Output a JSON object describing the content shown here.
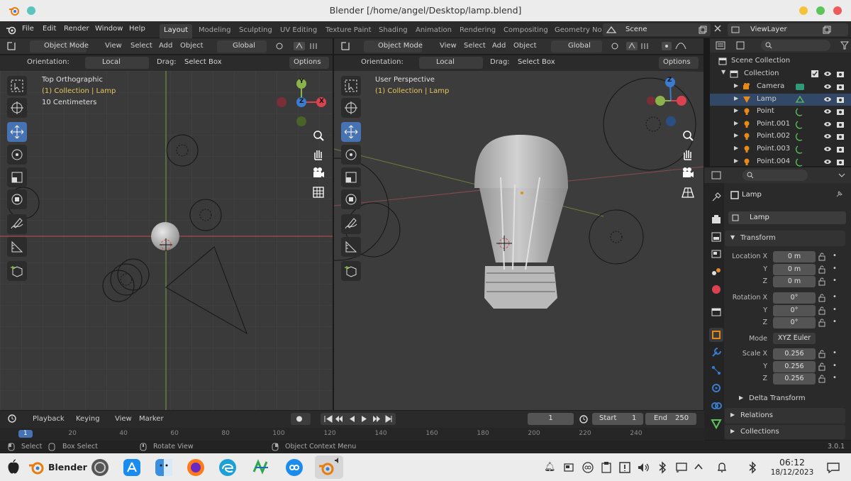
{
  "window": {
    "title": "Blender [/home/angel/Desktop/lamp.blend]"
  },
  "menu": [
    "File",
    "Edit",
    "Render",
    "Window",
    "Help"
  ],
  "workspaces": [
    "Layout",
    "Modeling",
    "Sculpting",
    "UV Editing",
    "Texture Paint",
    "Shading",
    "Animation",
    "Rendering",
    "Compositing",
    "Geometry No"
  ],
  "active_workspace": "Layout",
  "scene": "Scene",
  "view_layer": "ViewLayer",
  "viewport_header": {
    "mode": "Object Mode",
    "menus": [
      "View",
      "Select",
      "Add",
      "Object"
    ],
    "transform": "Global",
    "orientation_label": "Orientation:",
    "orientation_value": "Local",
    "drag_label": "Drag:",
    "drag_value": "Select Box",
    "options": "Options"
  },
  "viewport_left": {
    "title": "Top Orthographic",
    "collection": "(1) Collection | Lamp",
    "scale": "10 Centimeters"
  },
  "viewport_right": {
    "title": "User Perspective",
    "collection": "(1) Collection | Lamp"
  },
  "gizmo": {
    "x": "X",
    "y": "Y",
    "z": "Z"
  },
  "outliner": {
    "root": "Scene Collection",
    "collection": "Collection",
    "items": [
      "Camera",
      "Lamp",
      "Point",
      "Point.001",
      "Point.002",
      "Point.003",
      "Point.004"
    ]
  },
  "properties": {
    "object_name": "Lamp",
    "data_name": "Lamp",
    "transform_header": "Transform",
    "location_label": "Location X",
    "rotation_label": "Rotation X",
    "scale_label": "Scale X",
    "y_label": "Y",
    "z_label": "Z",
    "location": [
      "0 m",
      "0 m",
      "0 m"
    ],
    "rotation": [
      "0°",
      "0°",
      "0°"
    ],
    "mode_label": "Mode",
    "mode_value": "XYZ Euler",
    "scale": [
      "0.256",
      "0.256",
      "0.256"
    ],
    "delta_transform": "Delta Transform",
    "relations": "Relations",
    "collections": "Collections"
  },
  "timeline": {
    "menus": [
      "Playback",
      "Keying",
      "View",
      "Marker"
    ],
    "current_frame": "1",
    "start_label": "Start",
    "start": "1",
    "end_label": "End",
    "end": "250",
    "ruler": [
      "1",
      "20",
      "40",
      "60",
      "80",
      "100",
      "120",
      "140",
      "160",
      "180",
      "200",
      "220",
      "240"
    ]
  },
  "statusbar": {
    "select": "Select",
    "box_select": "Box Select",
    "rotate_view": "Rotate View",
    "context_menu": "Object Context Menu",
    "version": "3.0.1"
  },
  "dock": {
    "app_name": "Blender",
    "time": "06:12",
    "date": "18/12/2023"
  },
  "colors": {
    "accent": "#4772b3",
    "x_axis": "#d94350",
    "y_axis": "#8ab34a",
    "z_axis": "#3a7ccf",
    "selected_text": "#e5c75a"
  }
}
